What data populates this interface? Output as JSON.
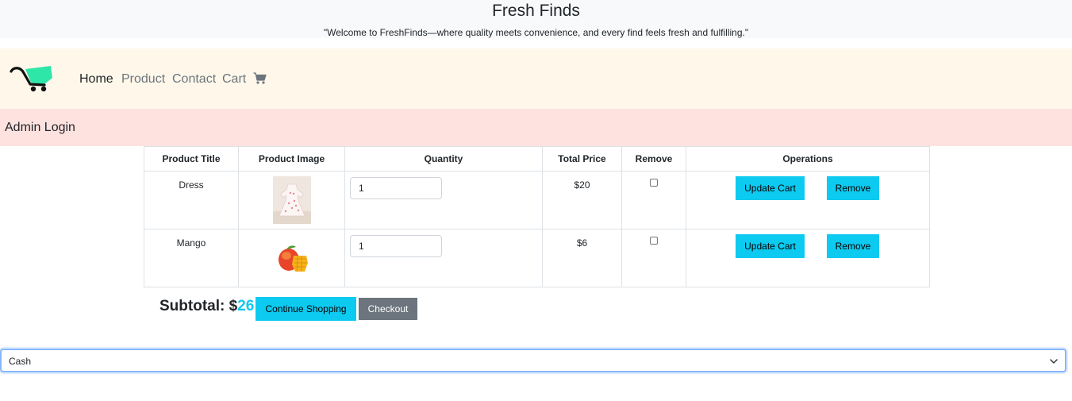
{
  "header": {
    "title": "Fresh Finds",
    "tagline": "\"Welcome to FreshFinds—where quality meets convenience, and every find feels fresh and fulfilling.\""
  },
  "nav": {
    "logo_icon": "shopping-cart-logo",
    "home": "Home",
    "product": "Product",
    "contact": "Contact",
    "cart": "Cart",
    "cart_icon": "cart-icon"
  },
  "admin": {
    "label": "Admin Login"
  },
  "table": {
    "headers": [
      "Product Title",
      "Product Image",
      "Quantity",
      "Total Price",
      "Remove",
      "Operations"
    ],
    "rows": [
      {
        "title": "Dress",
        "image": "dress-thumbnail",
        "quantity": "1",
        "price": "$20",
        "update_label": "Update Cart",
        "remove_label": "Remove"
      },
      {
        "title": "Mango",
        "image": "mango-thumbnail",
        "quantity": "1",
        "price": "$6",
        "update_label": "Update Cart",
        "remove_label": "Remove"
      }
    ]
  },
  "summary": {
    "subtotal_label": "Subtotal: $",
    "subtotal_amount": "26",
    "continue_label": "Continue Shopping",
    "checkout_label": "Checkout"
  },
  "payment": {
    "selected": "Cash"
  },
  "colors": {
    "accent": "#0dcaf0",
    "secondary": "#6c757d",
    "navbar_bg": "#fff8ea",
    "admin_bg": "#fde2df",
    "logo_green": "#2ee6a8"
  }
}
